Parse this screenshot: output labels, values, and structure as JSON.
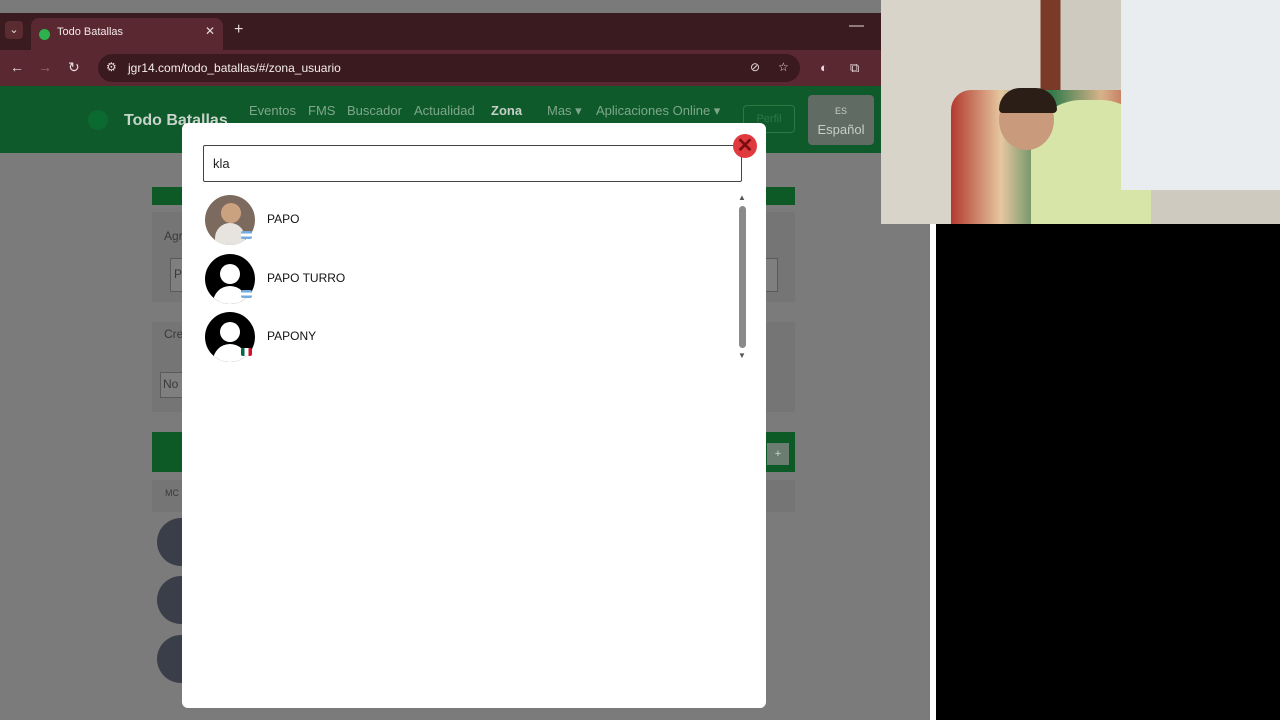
{
  "browser": {
    "tab_title": "Todo Batallas",
    "tab_close": "✕",
    "new_tab": "+",
    "minimize": "—",
    "url": "jgr14.com/todo_batallas/#/zona_usuario"
  },
  "site": {
    "logo_text": "Todo Batallas",
    "nav": [
      "Eventos",
      "FMS",
      "Buscador",
      "Actualidad",
      "Zona",
      "Mas ▾",
      "Aplicaciones Online ▾"
    ],
    "perfil_label": "Perfil",
    "lang_code": "ES",
    "lang_name": "Español",
    "bg_labels": {
      "agregar": "Agr",
      "input_p": "P",
      "crear": "Cre",
      "input_no": "No",
      "mc": "MC",
      "plus": "+"
    }
  },
  "modal": {
    "search_value": "kla",
    "close_symbol": "✕",
    "results": [
      {
        "name": "PAPO",
        "flag": "ar",
        "avatar": "photo"
      },
      {
        "name": "PAPO TURRO",
        "flag": "ar",
        "avatar": "default"
      },
      {
        "name": "PAPONY",
        "flag": "mx",
        "avatar": "default"
      }
    ]
  },
  "colors": {
    "accent_green": "#0d5a27",
    "close_red": "#e03a3f"
  }
}
